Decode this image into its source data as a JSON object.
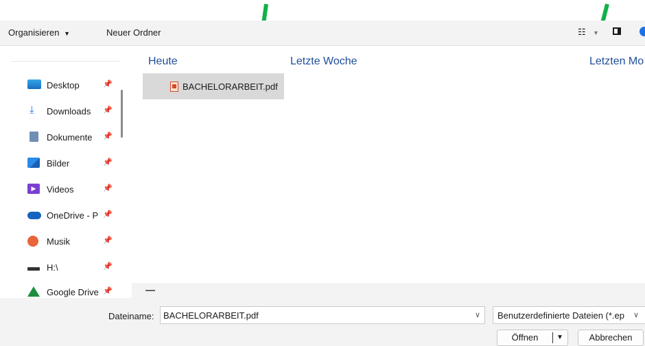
{
  "toolbar": {
    "organize": "Organisieren",
    "new_folder": "Neuer Ordner"
  },
  "sidebar": {
    "items": [
      {
        "label": "Desktop",
        "icon": "desktop-icon"
      },
      {
        "label": "Downloads",
        "icon": "download-icon"
      },
      {
        "label": "Dokumente",
        "icon": "document-icon"
      },
      {
        "label": "Bilder",
        "icon": "pictures-icon"
      },
      {
        "label": "Videos",
        "icon": "video-icon"
      },
      {
        "label": "OneDrive - P",
        "icon": "onedrive-icon"
      },
      {
        "label": "Musik",
        "icon": "music-icon"
      },
      {
        "label": "H:\\",
        "icon": "drive-icon"
      },
      {
        "label": "Google Drive",
        "icon": "google-drive-icon"
      }
    ]
  },
  "groups": {
    "today": "Heute",
    "last_week": "Letzte Woche",
    "last_month": "Letzten Mo"
  },
  "file": {
    "name": "BACHELORARBEIT.pdf"
  },
  "footer": {
    "filename_label": "Dateiname:",
    "filename_value": "BACHELORARBEIT.pdf",
    "filter_value": "Benutzerdefinierte Dateien (*.ep",
    "open_label": "Öffnen",
    "cancel_label": "Abbrechen"
  },
  "colors": {
    "arrow": "#11b04a",
    "group_header": "#1f4e9a"
  }
}
